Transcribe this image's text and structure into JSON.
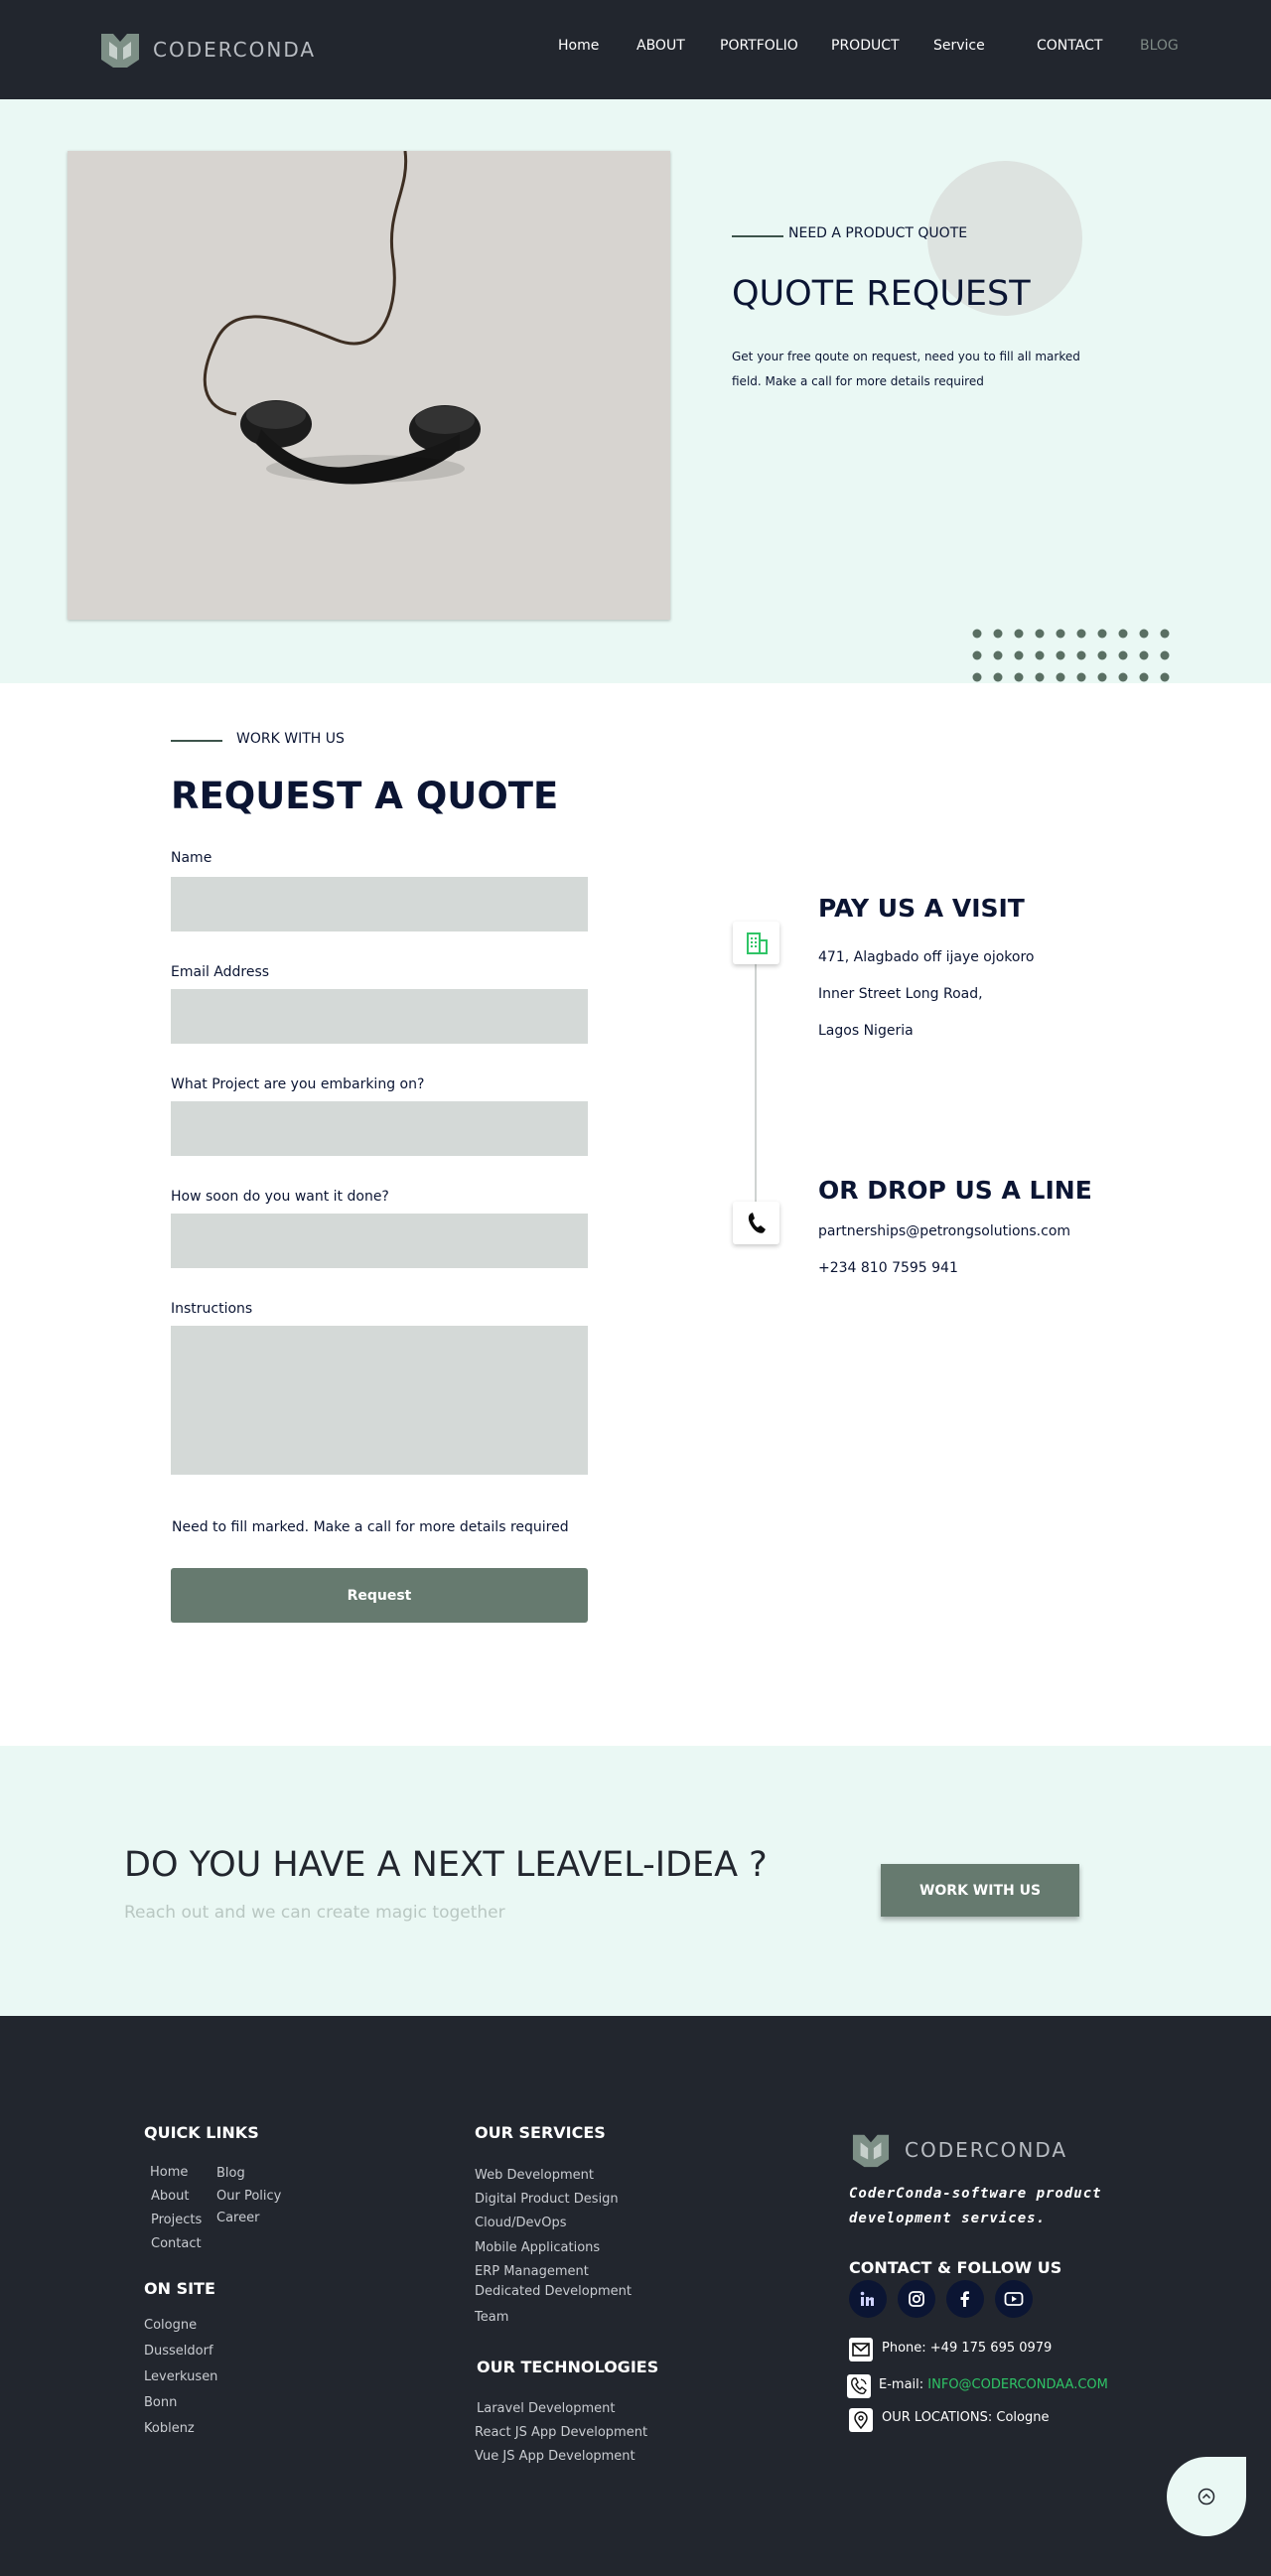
{
  "nav": {
    "logo_text": "CODERCONDA",
    "links": [
      "Home",
      "ABOUT",
      "PORTFOLIO",
      "PRODUCT",
      "Service",
      "CONTACT",
      "BLOG"
    ]
  },
  "hero": {
    "eyebrow": "NEED A PRODUCT QUOTE",
    "title": "QUOTE REQUEST",
    "description": "Get your free qoute on request, need you to fill all marked field. Make a call for more details required"
  },
  "form": {
    "eyebrow": "WORK WITH US",
    "title": "REQUEST A QUOTE",
    "fields": [
      {
        "label": "Name",
        "value": ""
      },
      {
        "label": "Email Address",
        "value": ""
      },
      {
        "label": "What Project are you embarking on?",
        "value": ""
      },
      {
        "label": "How soon do you want it done?",
        "value": ""
      },
      {
        "label": "Instructions",
        "value": ""
      }
    ],
    "note": "Need to fill marked. Make a call for more details required",
    "submit_label": "Request"
  },
  "contact": {
    "visit_title": "PAY US A VISIT",
    "address": [
      "471, Alagbado off ijaye ojokoro",
      "Inner Street Long Road,",
      "Lagos Nigeria"
    ],
    "line_title": "OR DROP US A LINE",
    "email": "partnerships@petrongsolutions.com",
    "phone": "+234 810 7595 941"
  },
  "cta": {
    "title": "DO YOU HAVE A NEXT LEAVEL-IDEA ?",
    "subtitle": "Reach out and we can create magic together",
    "button": "WORK WITH US"
  },
  "footer": {
    "quick_links_title": "QUICK LINKS",
    "quick_links_col1": [
      "Home",
      "About",
      "Projects",
      "Contact"
    ],
    "quick_links_col2": [
      "Blog",
      "Our Policy",
      "Career"
    ],
    "on_site_title": "ON SITE",
    "on_site": [
      "Cologne",
      "Dusseldorf",
      "Leverkusen",
      "Bonn",
      "Koblenz"
    ],
    "services_title": "OUR SERVICES",
    "services": [
      "Web Development",
      "Digital Product Design",
      "Cloud/DevOps",
      "Mobile Applications",
      "ERP Management",
      "Dedicated Development",
      "Team"
    ],
    "tech_title": "OUR TECHNOLOGIES",
    "technologies": [
      "Laravel Development",
      "React JS App Development",
      "Vue JS App Development"
    ],
    "logo_text": "CODERCONDA",
    "tagline": "CoderConda-software product development services.",
    "contact_title": "CONTACT & FOLLOW US",
    "phone_label": "Phone: +49 175 695 0979",
    "email_prefix": "E-mail:",
    "email": "INFO@CODERCONDAA.COM",
    "location": "OUR LOCATIONS: Cologne",
    "social_icons": [
      "linkedin-icon",
      "instagram-icon",
      "facebook-icon",
      "youtube-icon"
    ]
  },
  "colors": {
    "dark": "#22262e",
    "mint": "#eaf8f4",
    "accent": "#667a6f",
    "navy": "#0b1533",
    "green": "#2fc466"
  }
}
